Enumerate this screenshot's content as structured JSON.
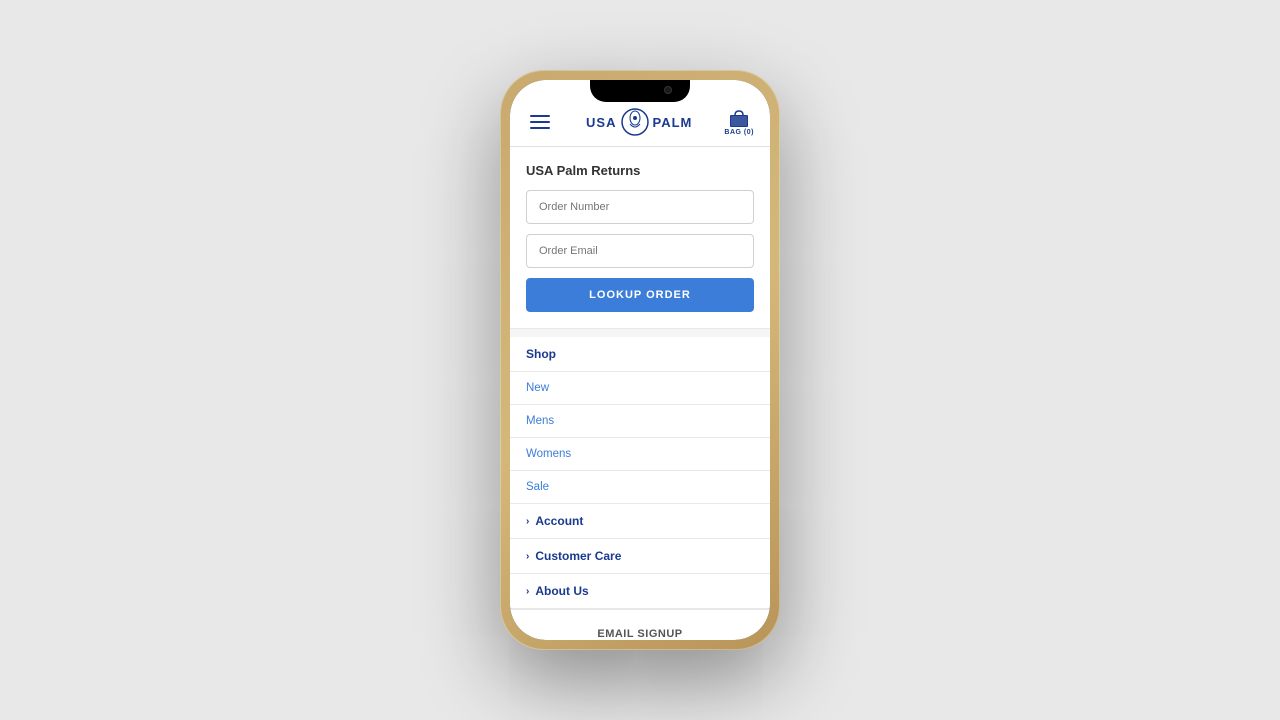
{
  "phone": {
    "notch": true
  },
  "header": {
    "logo_usa": "USA",
    "logo_palm": "PALM",
    "bag_label": "BAG (0)"
  },
  "returns": {
    "title": "USA Palm Returns",
    "order_number_placeholder": "Order Number",
    "order_email_placeholder": "Order Email",
    "lookup_button_label": "LOOKUP ORDER"
  },
  "nav": {
    "shop_label": "Shop",
    "items": [
      {
        "label": "New"
      },
      {
        "label": "Mens"
      },
      {
        "label": "Womens"
      },
      {
        "label": "Sale"
      }
    ],
    "expandable_items": [
      {
        "label": "Account"
      },
      {
        "label": "Customer Care"
      },
      {
        "label": "About Us"
      }
    ],
    "email_signup_label": "EMAIL SIGNUP"
  }
}
